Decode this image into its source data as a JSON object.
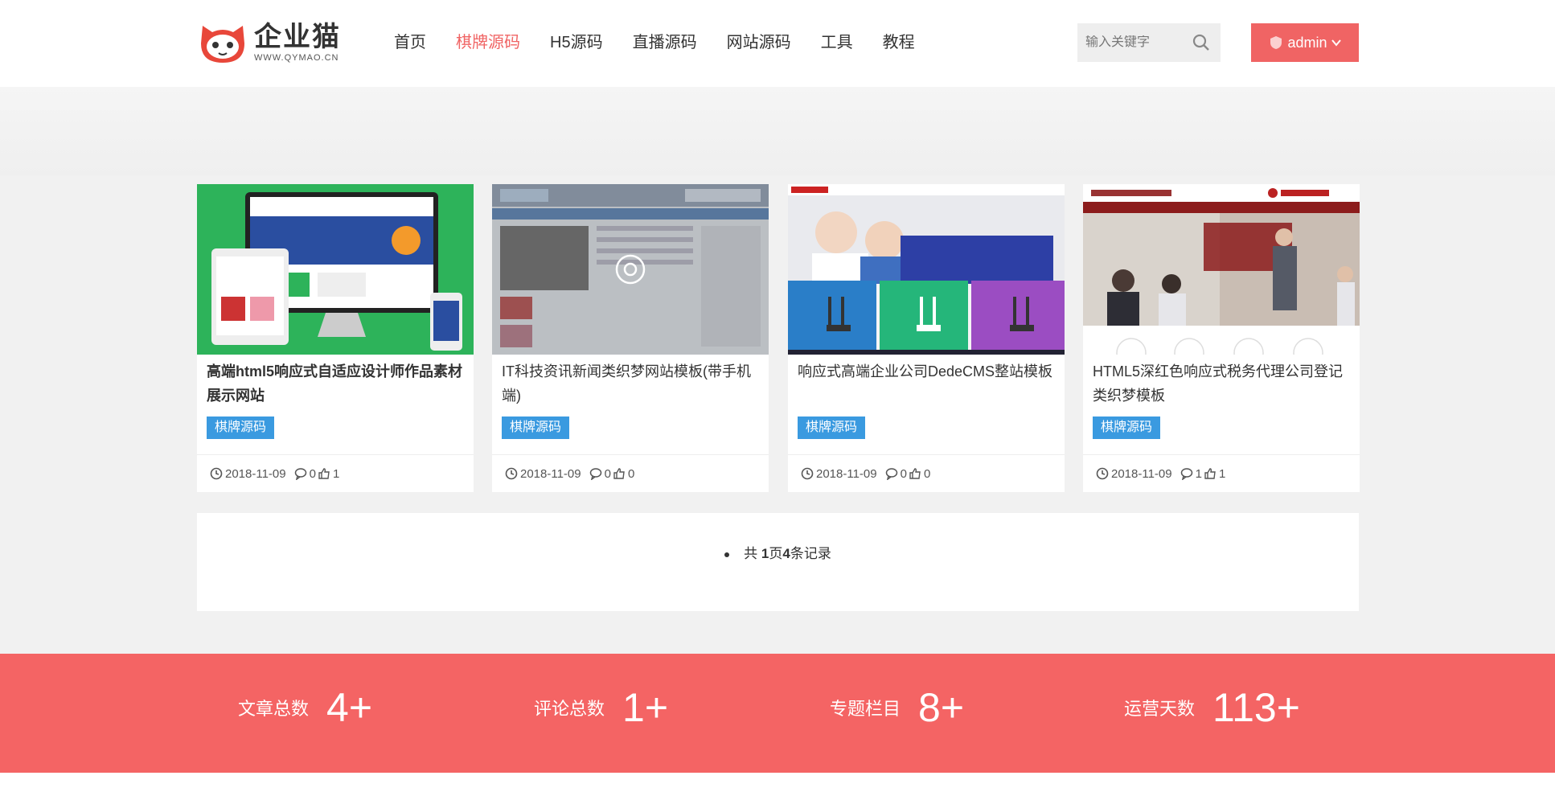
{
  "header": {
    "logo": {
      "name": "企业猫",
      "domain": "WWW.QYMAO.CN"
    },
    "nav": [
      "首页",
      "棋牌源码",
      "H5源码",
      "直播源码",
      "网站源码",
      "工具",
      "教程"
    ],
    "nav_active": "棋牌源码",
    "search": {
      "placeholder": "输入关键字"
    },
    "user": {
      "label": "admin"
    }
  },
  "cards": [
    {
      "title": "高端html5响应式自适应设计师作品素材展示网站",
      "tag": "棋牌源码",
      "date": "2018-11-09",
      "comments": "0",
      "likes": "1"
    },
    {
      "title": "IT科技资讯新闻类织梦网站模板(带手机端)",
      "tag": "棋牌源码",
      "date": "2018-11-09",
      "comments": "0",
      "likes": "0"
    },
    {
      "title": "响应式高端企业公司DedeCMS整站模板",
      "tag": "棋牌源码",
      "date": "2018-11-09",
      "comments": "0",
      "likes": "0"
    },
    {
      "title": "HTML5深红色响应式税务代理公司登记类织梦模板",
      "tag": "棋牌源码",
      "date": "2018-11-09",
      "comments": "1",
      "likes": "1"
    }
  ],
  "pagination": {
    "prefix": "共 ",
    "pages": "1",
    "mid": "页",
    "records": "4",
    "suffix": "条记录"
  },
  "stats": [
    {
      "label": "文章总数",
      "value": "4+"
    },
    {
      "label": "评论总数",
      "value": "1+"
    },
    {
      "label": "专题栏目",
      "value": "8+"
    },
    {
      "label": "运营天数",
      "value": "113+"
    }
  ],
  "colors": {
    "accent": "#f06464",
    "tag": "#3a9ae0",
    "stats_bg": "#f46464"
  }
}
